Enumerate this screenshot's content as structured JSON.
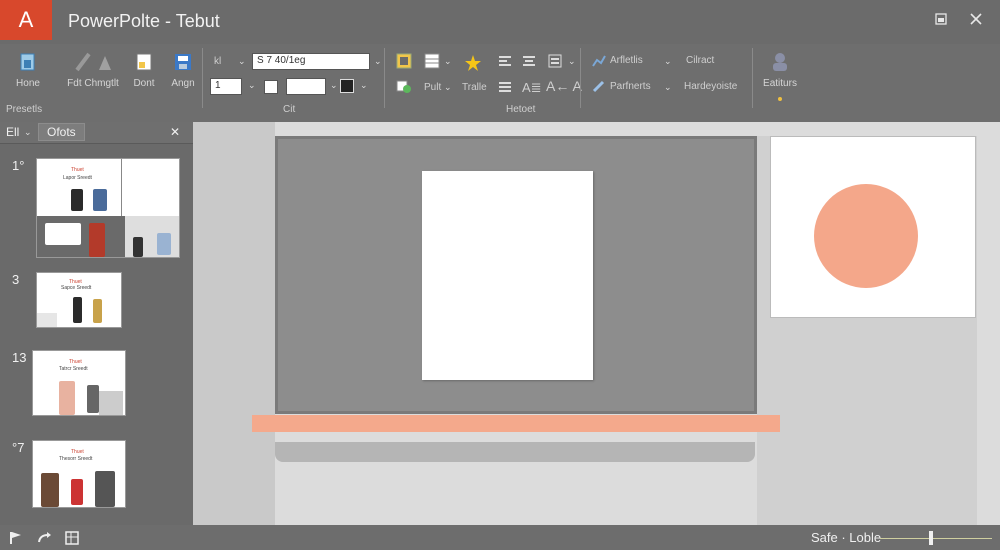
{
  "titlebar": {
    "badge": "A",
    "title": "PowerPolte - Tebut"
  },
  "ribbon": {
    "buttons": {
      "home": "Hone",
      "changes": "Fdt Chmgtlt",
      "dont": "Dont",
      "angn": "Angn"
    },
    "font_box": "S 7 40/1eg",
    "font_prefix": "kl",
    "size_box": "1",
    "quickstyle_label": "Pult",
    "shapes_label": "Tralle",
    "text_label": "A≣",
    "aa_label": "A← A",
    "articlis": "Arfletlis",
    "cilract": "Cilract",
    "perfnerts": "Parfnerts",
    "hardeyoiste": "Hardeyoiste",
    "estiturs": "Eatiturs",
    "groups": {
      "left": "Presetls",
      "middle": "Cit",
      "right": "Hetoet"
    }
  },
  "left_panel": {
    "tab_label_left": "Ell",
    "tab_label_active": "Ofots",
    "close": "✕",
    "slides": [
      {
        "num": "1°",
        "title": "Thuet",
        "subtitle": "Lapor Sreedt"
      },
      {
        "num": "3",
        "title": "Thuet",
        "subtitle": "Sapce Sreedt"
      },
      {
        "num": "13",
        "title": "Thuet",
        "subtitle": "Tatrcr Sreedt"
      },
      {
        "num": "°7",
        "title": "Thuet",
        "subtitle": "Thesorr Sreedt"
      }
    ]
  },
  "statusbar": {
    "text": "Safe · Loble"
  },
  "colors": {
    "accent": "#d8482c",
    "salmon": "#f4a98c"
  },
  "icons": {
    "home": "home-icon",
    "pen": "pen-icon",
    "doc": "document-icon",
    "save": "save-icon",
    "star": "star-icon",
    "person": "person-icon"
  }
}
